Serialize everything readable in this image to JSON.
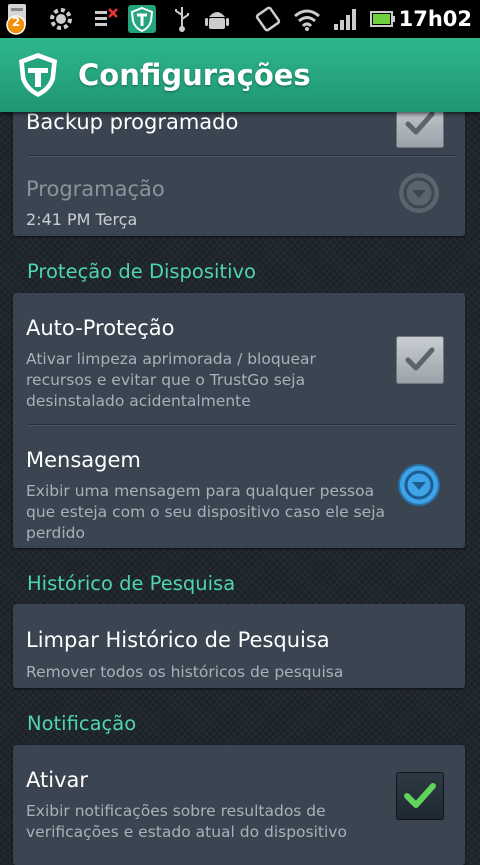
{
  "status_bar": {
    "notification_count": "2",
    "time": "17h02",
    "icons": [
      "notification-badge-icon",
      "settings-notification-icon",
      "no-signal-icon",
      "trustgo-icon",
      "usb-icon",
      "android-debug-icon",
      "screen-rotate-icon",
      "wifi-icon",
      "signal-icon",
      "battery-icon"
    ]
  },
  "app_bar": {
    "title": "Configurações",
    "logo": "trustgo-shield-icon"
  },
  "colors": {
    "accent": "#2fb68d",
    "section": "#4fd6ad",
    "card": "#3a4551",
    "check_green": "#5fd35a",
    "dropdown_blue": "#3fa3e8"
  },
  "settings": {
    "backup": {
      "title": "Backup programado"
    },
    "schedule": {
      "title": "Programação",
      "subtitle": "2:41 PM Terça"
    },
    "device_section": "Proteção de Dispositivo",
    "self_protect": {
      "title": "Auto-Proteção",
      "subtitle": "Ativar limpeza aprimorada / bloquear recursos e evitar que o TrustGo seja desinstalado acidentalmente"
    },
    "message": {
      "title": "Mensagem",
      "subtitle": "Exibir uma mensagem para qualquer pessoa que esteja com o seu dispositivo caso ele seja perdido"
    },
    "history_section": "Histórico de Pesquisa",
    "clear_history": {
      "title": "Limpar Histórico de Pesquisa",
      "subtitle": "Remover todos os históricos de pesquisa"
    },
    "notification_section": "Notificação",
    "activate": {
      "title": "Ativar",
      "subtitle": "Exibir notificações sobre resultados de verificações e estado atual do dispositivo"
    }
  }
}
